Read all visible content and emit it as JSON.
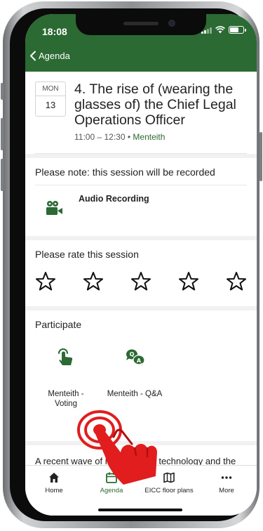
{
  "status": {
    "time": "18:08"
  },
  "nav": {
    "back_label": "Agenda"
  },
  "session": {
    "day_of_week": "MON",
    "day_number": "13",
    "title": "4. The rise of (wearing the glasses of) the Chief Legal Operations Officer",
    "time_range": "11:00 – 12:30",
    "separator": "•",
    "room": "Menteith"
  },
  "recording": {
    "heading": "Please note: this session will be recorded",
    "label": "Audio Recording",
    "icon": "video-camera-icon"
  },
  "rating": {
    "heading": "Please rate this session",
    "star_count": 5,
    "value": 0
  },
  "participate": {
    "heading": "Participate",
    "items": [
      {
        "label": "Menteith - Voting",
        "icon": "tap-icon"
      },
      {
        "label": "Menteith - Q&A",
        "icon": "chat-bubbles-icon"
      }
    ]
  },
  "description": "A recent wave of innovation in technology and the availability of new tools for your team are",
  "tabs": [
    {
      "label": "Home",
      "icon": "home-icon",
      "active": false
    },
    {
      "label": "Agenda",
      "icon": "calendar-icon",
      "active": true
    },
    {
      "label": "EICC floor plans",
      "icon": "map-icon",
      "active": false
    },
    {
      "label": "More",
      "icon": "more-icon",
      "active": false
    }
  ],
  "colors": {
    "brand": "#2b6a33",
    "hand": "#e11d1d"
  }
}
